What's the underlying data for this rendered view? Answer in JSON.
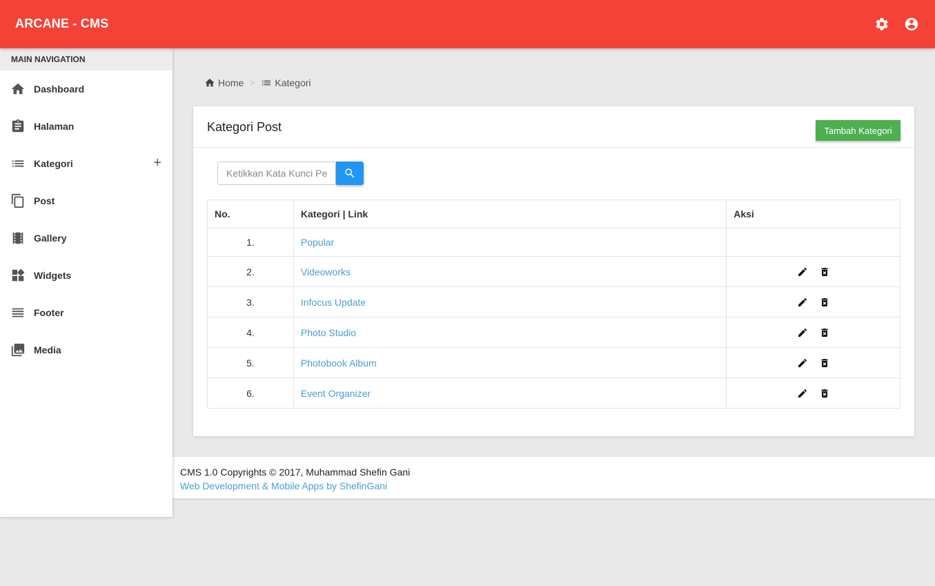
{
  "app": {
    "title": "ARCANE - CMS"
  },
  "colors": {
    "topbar": "#f44336",
    "add_button": "#4caf50",
    "search_button": "#2196f3",
    "link": "#4a9fd0"
  },
  "topbar_icons": {
    "settings": "gear-icon",
    "account": "account-circle-icon"
  },
  "sidebar": {
    "header": "MAIN NAVIGATION",
    "items": [
      {
        "label": "Dashboard",
        "icon": "home-icon"
      },
      {
        "label": "Halaman",
        "icon": "clipboard-icon"
      },
      {
        "label": "Kategori",
        "icon": "list-icon",
        "expand": "+"
      },
      {
        "label": "Post",
        "icon": "copy-icon"
      },
      {
        "label": "Gallery",
        "icon": "film-icon"
      },
      {
        "label": "Widgets",
        "icon": "widgets-icon"
      },
      {
        "label": "Footer",
        "icon": "lines-icon"
      },
      {
        "label": "Media",
        "icon": "photo-library-icon"
      }
    ]
  },
  "breadcrumb": {
    "items": [
      {
        "label": "Home",
        "icon": "home-icon"
      },
      {
        "label": "Kategori",
        "icon": "list-icon"
      }
    ],
    "separator": ">"
  },
  "card": {
    "title": "Kategori Post",
    "add_button": "Tambah Kategori",
    "search": {
      "placeholder": "Ketikkan Kata Kunci Pencarian",
      "value": ""
    }
  },
  "table": {
    "headers": [
      "No.",
      "Kategori | Link",
      "Aksi"
    ],
    "rows": [
      {
        "no": "1.",
        "name": "Popular",
        "actions": false
      },
      {
        "no": "2.",
        "name": "Videoworks",
        "actions": true
      },
      {
        "no": "3.",
        "name": "Infocus Update",
        "actions": true
      },
      {
        "no": "4.",
        "name": "Photo Studio",
        "actions": true
      },
      {
        "no": "5.",
        "name": "Photobook Album",
        "actions": true
      },
      {
        "no": "6.",
        "name": "Event Organizer",
        "actions": true
      }
    ]
  },
  "footer": {
    "copyright": "CMS 1.0 Copyrights © 2017, Muhammad Shefin Gani",
    "credit": "Web Development & Mobile Apps by ShefinGani"
  }
}
